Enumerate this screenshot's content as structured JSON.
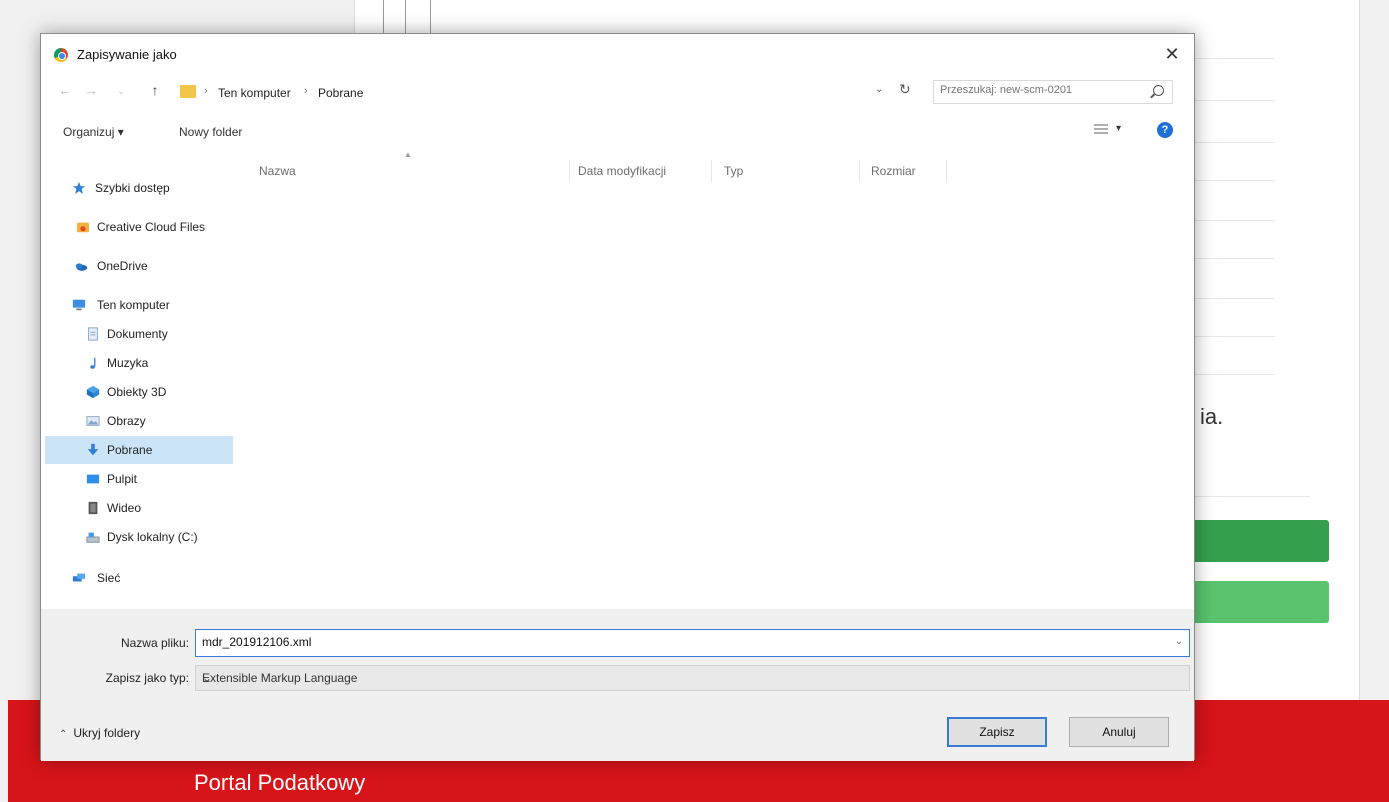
{
  "background": {
    "snippet_text": "ia.",
    "brand": "Portal Podatkowy"
  },
  "dialog": {
    "title": "Zapisywanie jako",
    "address": {
      "crumbs": [
        "Ten komputer",
        "Pobrane"
      ],
      "search_placeholder": "Przeszukaj: new-scm-0201"
    },
    "toolbar": {
      "organize_label": "Organizuj ▾",
      "new_folder_label": "Nowy folder"
    },
    "nav": [
      {
        "label": "Szybki dostęp",
        "icon": "star-icon"
      },
      {
        "label": "Creative Cloud Files",
        "icon": "creative-cloud-icon"
      },
      {
        "label": "OneDrive",
        "icon": "onedrive-icon"
      },
      {
        "label": "Ten komputer",
        "icon": "computer-icon"
      },
      {
        "label": "Dokumenty",
        "icon": "documents-icon"
      },
      {
        "label": "Muzyka",
        "icon": "music-icon"
      },
      {
        "label": "Obiekty 3D",
        "icon": "3d-objects-icon"
      },
      {
        "label": "Obrazy",
        "icon": "pictures-icon"
      },
      {
        "label": "Pobrane",
        "icon": "download-icon",
        "selected": true
      },
      {
        "label": "Pulpit",
        "icon": "desktop-icon"
      },
      {
        "label": "Wideo",
        "icon": "video-icon"
      },
      {
        "label": "Dysk lokalny (C:)",
        "icon": "drive-icon"
      },
      {
        "label": "Sieć",
        "icon": "network-icon"
      }
    ],
    "columns": [
      "Nazwa",
      "Data modyfikacji",
      "Typ",
      "Rozmiar"
    ],
    "filename_label": "Nazwa pliku:",
    "filename_value": "mdr_201912106.xml",
    "filetype_label": "Zapisz jako typ:",
    "filetype_value": "Extensible Markup Language",
    "hide_folders_label": "Ukryj foldery",
    "save_label": "Zapisz",
    "cancel_label": "Anuluj",
    "colors": {
      "accent": "#3c7bd5",
      "selection": "#cce4f7",
      "brand_red": "#d7141a",
      "button_green": "#34a04d"
    }
  }
}
